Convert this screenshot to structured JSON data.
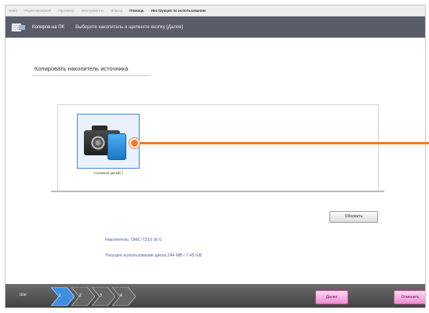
{
  "menu": {
    "items": [
      "Файл",
      "Редактирование",
      "Просмотр",
      "Инструменты",
      "Эпизод",
      "Помощь",
      "Инструкция по использованию"
    ],
    "active_index": 5
  },
  "window": {
    "title": "Копиров.на ПК",
    "instruction": "Выберите накопитель и щелкните кнопку [Далее]"
  },
  "section": {
    "title": "Копировать накопитель источника"
  },
  "drive": {
    "label": "Съемный диск(E:)",
    "icon": "camera-sd-card-icon"
  },
  "refresh_button": "Обновить",
  "info": {
    "drive_line": "Накопитель: DMC-TZ10 (E:\\)",
    "usage_line": "Текущее использование диска 244 MB / 7.45 GB"
  },
  "footer": {
    "step_zero": "Шаг",
    "steps": [
      "1",
      "2",
      "3",
      "4"
    ],
    "current_step": 1,
    "done_label": "Далее",
    "cancel_label": "Отменить"
  },
  "colors": {
    "titlebar": "#595d69",
    "accent_callout": "#f07a2a",
    "selection": "#4a86d6",
    "step_active": "#3d8fe0",
    "button_pink": "#ec8bd2"
  }
}
